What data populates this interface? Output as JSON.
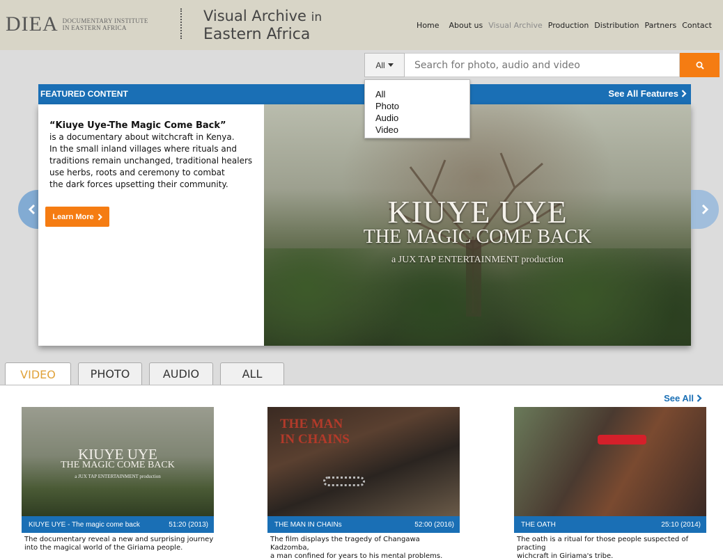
{
  "header": {
    "logo_mark": "DIEA",
    "logo_sub_line1": "DOCUMENTARY INSTITUTE",
    "logo_sub_line2": "IN EASTERN AFRICA",
    "site_title_line1": "Visual Archive",
    "site_title_in": "in",
    "site_title_line2": "Eastern Africa",
    "nav": [
      "Home",
      "About us",
      "Visual Archive",
      "Production",
      "Distribution",
      "Partners",
      "Contact"
    ],
    "active_nav": "Visual Archive"
  },
  "search": {
    "scope_selected": "All",
    "placeholder": "Search for photo, audio and video",
    "scope_options": [
      "All",
      "Photo",
      "Audio",
      "Video"
    ]
  },
  "featured": {
    "section_title": "FEATURED CONTENT",
    "see_all": "See All Features",
    "title": "“Kiuye Uye-The Magic Come Back”",
    "description_lines": [
      "is a documentary about witchcraft in Kenya.",
      "In the small inland villages where rituals and",
      "traditions remain unchanged, traditional healers",
      "use herbs, roots and ceremony to combat",
      "the dark forces upsetting their community."
    ],
    "learn_more": "Learn More",
    "poster": {
      "line1": "KIUYE UYE",
      "line2": "THE MAGIC COME BACK",
      "line3": "a JUX TAP ENTERTAINMENT production"
    }
  },
  "tabs": [
    "VIDEO",
    "PHOTO",
    "AUDIO",
    "ALL"
  ],
  "active_tab": "VIDEO",
  "see_all": "See All",
  "videos": [
    {
      "title": "KIUYE UYE - The magic come back",
      "meta": "51:20 (2013)",
      "desc_line1": "The documentary reveal a new and surprising journey",
      "desc_line2": "into the magical world of the Giriama people.",
      "poster_line1": "KIUYE UYE",
      "poster_line2": "THE MAGIC COME BACK",
      "poster_line3": "a JUX TAP ENTERTAINMENT production"
    },
    {
      "title": "THE MAN IN CHAINs",
      "meta": "52:00 (2016)",
      "desc_line1": "The film displays the tragedy of Changawa Kadzomba,",
      "desc_line2": "a man confined for years to his mental problems.",
      "poster_line1": "THE MAN",
      "poster_line2": "IN CHAINS"
    },
    {
      "title": "THE OATH",
      "meta": "25:10 (2014)",
      "desc_line1": "The oath is a ritual for those people suspected of practing",
      "desc_line2": "wichcraft in Giriama's tribe."
    }
  ],
  "colors": {
    "brand_blue": "#1a6fb5",
    "accent_orange": "#f57c12",
    "header_bg": "#d8d5c7"
  }
}
